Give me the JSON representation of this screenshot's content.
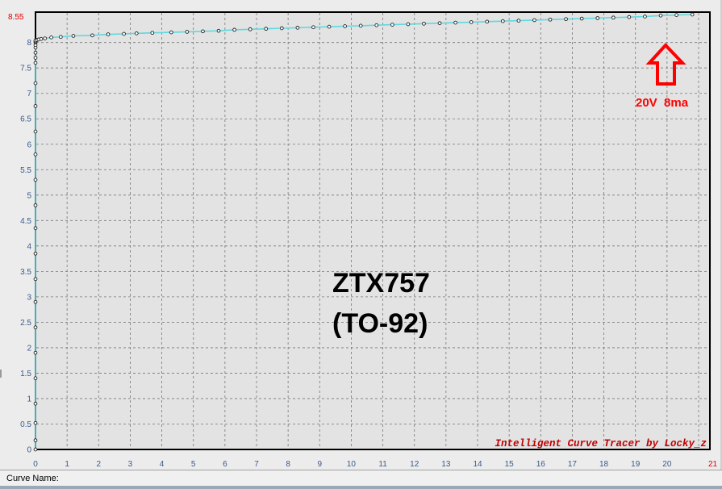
{
  "status_bar": {
    "curve_name_label": "Curve Name:"
  },
  "chart_data": {
    "type": "line",
    "xlim": [
      0,
      21
    ],
    "ylim": [
      0,
      8.55
    ],
    "x_ticks": [
      0,
      1,
      2,
      3,
      4,
      5,
      6,
      7,
      8,
      9,
      10,
      11,
      12,
      13,
      14,
      15,
      16,
      17,
      18,
      19,
      20,
      21
    ],
    "y_ticks": [
      0,
      0.5,
      1,
      1.5,
      2,
      2.5,
      3,
      3.5,
      4,
      4.5,
      5,
      5.5,
      6,
      6.5,
      7,
      7.5,
      8
    ],
    "x_max_label": "21",
    "y_max_label": "8.55",
    "grid": true,
    "series": [
      {
        "values_x": [
          0,
          0,
          0,
          0,
          0,
          0,
          0,
          0,
          0,
          0,
          0,
          0,
          0,
          0,
          0,
          0,
          0,
          0,
          0,
          0,
          0,
          0,
          0,
          0,
          0,
          0.05,
          0.1,
          0.18,
          0.3,
          0.5,
          0.8,
          1.2,
          1.8,
          2.3,
          2.8,
          3.2,
          3.7,
          4.3,
          4.8,
          5.3,
          5.8,
          6.3,
          6.8,
          7.3,
          7.8,
          8.3,
          8.8,
          9.3,
          9.8,
          10.3,
          10.8,
          11.3,
          11.8,
          12.3,
          12.8,
          13.3,
          13.8,
          14.3,
          14.8,
          15.3,
          15.8,
          16.3,
          16.8,
          17.3,
          17.8,
          18.3,
          18.8,
          19.3,
          19.8,
          20.3,
          20.8
        ],
        "values_y": [
          0,
          0.18,
          0.52,
          0.9,
          1.4,
          1.9,
          2.4,
          2.9,
          3.35,
          3.85,
          4.35,
          4.8,
          5.3,
          5.8,
          6.25,
          6.75,
          7.2,
          7.6,
          7.7,
          7.8,
          7.9,
          7.95,
          8.0,
          8.02,
          8.04,
          8.05,
          8.06,
          8.07,
          8.08,
          8.1,
          8.11,
          8.13,
          8.14,
          8.16,
          8.17,
          8.18,
          8.19,
          8.2,
          8.21,
          8.22,
          8.23,
          8.25,
          8.26,
          8.27,
          8.28,
          8.29,
          8.3,
          8.31,
          8.32,
          8.33,
          8.34,
          8.35,
          8.36,
          8.37,
          8.38,
          8.39,
          8.4,
          8.41,
          8.42,
          8.43,
          8.44,
          8.45,
          8.46,
          8.47,
          8.48,
          8.49,
          8.5,
          8.51,
          8.53,
          8.54,
          8.55
        ]
      }
    ],
    "annotations": {
      "device_name": "ZTX757",
      "package": "(TO-92)",
      "condition_label": "20V  8ma",
      "watermark": "Intelligent Curve Tracer by Locky_z"
    },
    "colors": {
      "curve": "#5fd8e0",
      "marker": "#222222",
      "grid": "#777777",
      "tick_text": "#3a5a8a",
      "max_label": "#e00000",
      "arrow": "#ff0000",
      "watermark": "#c00000",
      "plot_bg": "#e3e3e3"
    }
  }
}
